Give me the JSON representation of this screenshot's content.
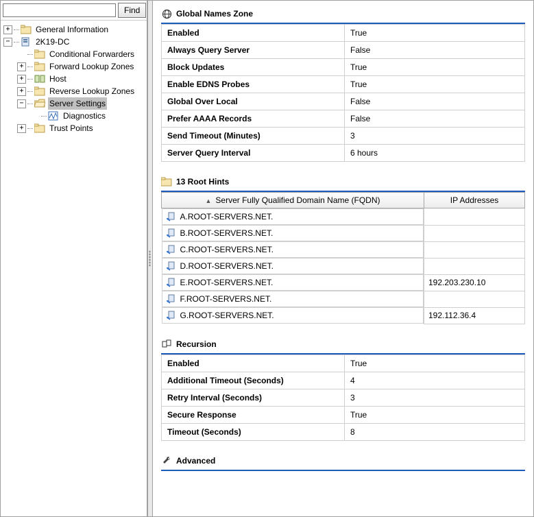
{
  "search": {
    "placeholder": "",
    "button": "Find"
  },
  "tree": {
    "root1": "General Information",
    "root2": "2K19-DC",
    "n_condfwd": "Conditional Forwarders",
    "n_flz": "Forward Lookup Zones",
    "n_host": "Host",
    "n_rlz": "Reverse Lookup Zones",
    "n_ss": "Server Settings",
    "n_diag": "Diagnostics",
    "n_tp": "Trust Points"
  },
  "sections": {
    "gnz": {
      "title": "Global Names Zone",
      "rows": [
        {
          "k": "Enabled",
          "v": "True"
        },
        {
          "k": "Always Query Server",
          "v": "False"
        },
        {
          "k": "Block Updates",
          "v": "True"
        },
        {
          "k": "Enable EDNS Probes",
          "v": "True"
        },
        {
          "k": "Global Over Local",
          "v": "False"
        },
        {
          "k": "Prefer AAAA Records",
          "v": "False"
        },
        {
          "k": "Send Timeout (Minutes)",
          "v": "3"
        },
        {
          "k": "Server Query Interval",
          "v": "6 hours"
        }
      ]
    },
    "roothints": {
      "title": "13 Root Hints",
      "col1": "Server Fully Qualified Domain Name (FQDN)",
      "col2": "IP Addresses",
      "rows": [
        {
          "fqdn": "A.ROOT-SERVERS.NET.",
          "ip": ""
        },
        {
          "fqdn": "B.ROOT-SERVERS.NET.",
          "ip": ""
        },
        {
          "fqdn": "C.ROOT-SERVERS.NET.",
          "ip": ""
        },
        {
          "fqdn": "D.ROOT-SERVERS.NET.",
          "ip": ""
        },
        {
          "fqdn": "E.ROOT-SERVERS.NET.",
          "ip": "192.203.230.10"
        },
        {
          "fqdn": "F.ROOT-SERVERS.NET.",
          "ip": ""
        },
        {
          "fqdn": "G.ROOT-SERVERS.NET.",
          "ip": "192.112.36.4"
        }
      ]
    },
    "recursion": {
      "title": "Recursion",
      "rows": [
        {
          "k": "Enabled",
          "v": "True"
        },
        {
          "k": "Additional Timeout (Seconds)",
          "v": "4"
        },
        {
          "k": "Retry Interval (Seconds)",
          "v": "3"
        },
        {
          "k": "Secure Response",
          "v": "True"
        },
        {
          "k": "Timeout (Seconds)",
          "v": "8"
        }
      ]
    },
    "advanced": {
      "title": "Advanced"
    }
  }
}
